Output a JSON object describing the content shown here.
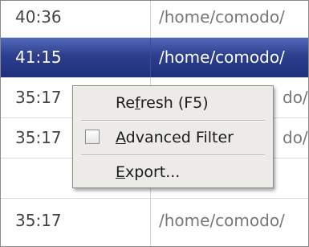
{
  "rows": [
    {
      "time": "40:36",
      "path": "/home/comodo/"
    },
    {
      "time": "41:15",
      "path": "/home/comodo/"
    },
    {
      "time": "35:17",
      "path": "do/"
    },
    {
      "time": "35:17",
      "path": "do/"
    },
    {
      "time": "35:17",
      "path": "/home/comodo/"
    }
  ],
  "context_menu": {
    "refresh": {
      "pre": "Re",
      "accel": "f",
      "post": "resh (F5)"
    },
    "advanced_filter": {
      "pre": "",
      "accel": "A",
      "post": "dvanced Filter",
      "checked": false
    },
    "export": {
      "pre": "",
      "accel": "E",
      "post": "xport..."
    }
  },
  "colors": {
    "selection": "#2c3f8e",
    "menu_bg": "#ecebe8"
  }
}
